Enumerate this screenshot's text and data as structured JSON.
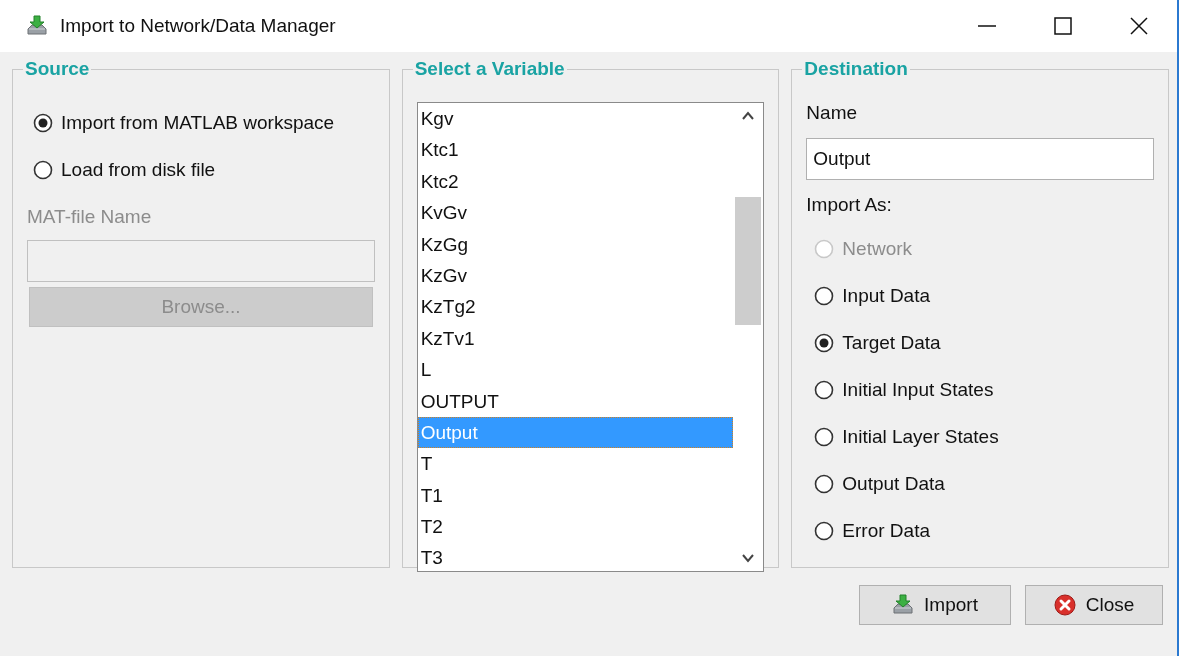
{
  "window": {
    "title": "Import to Network/Data Manager"
  },
  "source": {
    "legend": "Source",
    "options": [
      {
        "label": "Import from MATLAB workspace",
        "selected": true
      },
      {
        "label": "Load from disk file",
        "selected": false
      }
    ],
    "file_label": "MAT-file Name",
    "file_field": {
      "disabled": true
    },
    "browse_button": {
      "label": "Browse...",
      "disabled": true
    }
  },
  "variables": {
    "legend": "Select a Variable",
    "items": [
      {
        "label": "Kgv",
        "selected": false
      },
      {
        "label": "Ktc1",
        "selected": false
      },
      {
        "label": "Ktc2",
        "selected": false
      },
      {
        "label": "KvGv",
        "selected": false
      },
      {
        "label": "KzGg",
        "selected": false
      },
      {
        "label": "KzGv",
        "selected": false
      },
      {
        "label": "KzTg2",
        "selected": false
      },
      {
        "label": "KzTv1",
        "selected": false
      },
      {
        "label": "L",
        "selected": false
      },
      {
        "label": "OUTPUT",
        "selected": false
      },
      {
        "label": "Output",
        "selected": true
      },
      {
        "label": "T",
        "selected": false
      },
      {
        "label": "T1",
        "selected": false
      },
      {
        "label": "T2",
        "selected": false
      },
      {
        "label": "T3",
        "selected": false
      }
    ]
  },
  "destination": {
    "legend": "Destination",
    "name_label": "Name",
    "name_value": "Output",
    "import_as_label": "Import As:",
    "options": [
      {
        "label": "Network",
        "selected": false,
        "disabled": true
      },
      {
        "label": "Input Data",
        "selected": false,
        "disabled": false
      },
      {
        "label": "Target Data",
        "selected": true,
        "disabled": false
      },
      {
        "label": "Initial Input States",
        "selected": false,
        "disabled": false
      },
      {
        "label": "Initial Layer States",
        "selected": false,
        "disabled": false
      },
      {
        "label": "Output Data",
        "selected": false,
        "disabled": false
      },
      {
        "label": "Error Data",
        "selected": false,
        "disabled": false
      }
    ]
  },
  "buttons": [
    {
      "label": "Import",
      "kind": "import"
    },
    {
      "label": "Close",
      "kind": "close"
    }
  ]
}
